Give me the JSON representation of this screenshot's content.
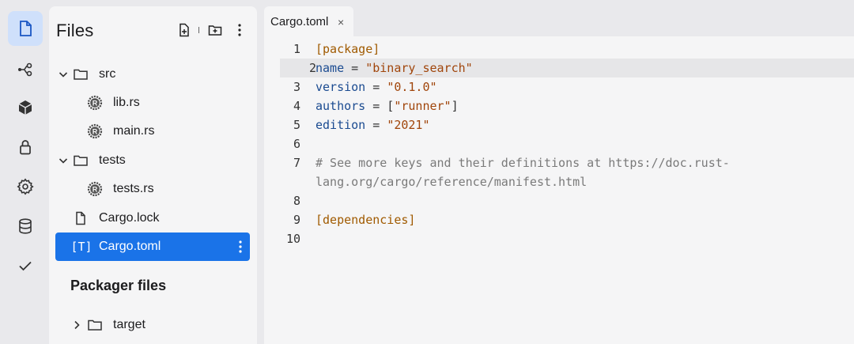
{
  "rail": {
    "items": [
      {
        "icon": "file-icon",
        "active": true
      },
      {
        "icon": "git-branch-icon",
        "active": false
      },
      {
        "icon": "package-icon",
        "active": false
      },
      {
        "icon": "lock-icon",
        "active": false
      },
      {
        "icon": "gear-icon",
        "active": false
      },
      {
        "icon": "database-icon",
        "active": false
      },
      {
        "icon": "check-icon",
        "active": false
      }
    ]
  },
  "files": {
    "title": "Files",
    "tree": [
      {
        "label": "src",
        "type": "folder",
        "expanded": true
      },
      {
        "label": "lib.rs",
        "type": "rust-file"
      },
      {
        "label": "main.rs",
        "type": "rust-file"
      },
      {
        "label": "tests",
        "type": "folder",
        "expanded": true
      },
      {
        "label": "tests.rs",
        "type": "rust-file"
      },
      {
        "label": "Cargo.lock",
        "type": "file"
      },
      {
        "label": "Cargo.toml",
        "type": "toml-file",
        "selected": true
      }
    ],
    "toml_badge": "[T]",
    "packager": {
      "title": "Packager files",
      "items": [
        {
          "label": "target",
          "type": "folder",
          "expanded": false
        }
      ]
    }
  },
  "editor": {
    "tab": {
      "label": "Cargo.toml",
      "close": "×"
    },
    "lines": [
      {
        "num": "1",
        "tokens": [
          {
            "t": "[package]",
            "c": "c-section"
          }
        ]
      },
      {
        "num": "2",
        "tokens": [
          {
            "t": "name",
            "c": "c-key"
          },
          {
            "t": " = ",
            "c": "c-op"
          },
          {
            "t": "\"binary_search\"",
            "c": "c-str"
          }
        ],
        "highlight": true
      },
      {
        "num": "3",
        "tokens": [
          {
            "t": "version",
            "c": "c-key"
          },
          {
            "t": " = ",
            "c": "c-op"
          },
          {
            "t": "\"0.1.0\"",
            "c": "c-str"
          }
        ]
      },
      {
        "num": "4",
        "tokens": [
          {
            "t": "authors",
            "c": "c-key"
          },
          {
            "t": " = [",
            "c": "c-op"
          },
          {
            "t": "\"runner\"",
            "c": "c-str"
          },
          {
            "t": "]",
            "c": "c-op"
          }
        ]
      },
      {
        "num": "5",
        "tokens": [
          {
            "t": "edition",
            "c": "c-key"
          },
          {
            "t": " = ",
            "c": "c-op"
          },
          {
            "t": "\"2021\"",
            "c": "c-str"
          }
        ]
      },
      {
        "num": "6",
        "tokens": []
      },
      {
        "num": "7",
        "tokens": [
          {
            "t": "# See more keys and their definitions at https://doc.rust-",
            "c": "c-comment"
          }
        ]
      },
      {
        "num": "",
        "tokens": [
          {
            "t": "lang.org/cargo/reference/manifest.html",
            "c": "c-comment"
          }
        ]
      },
      {
        "num": "8",
        "tokens": []
      },
      {
        "num": "9",
        "tokens": [
          {
            "t": "[dependencies]",
            "c": "c-section"
          }
        ]
      },
      {
        "num": "10",
        "tokens": []
      }
    ]
  },
  "colors": {
    "accent": "#1a73e8",
    "active_rail": "#cfe0fb"
  }
}
